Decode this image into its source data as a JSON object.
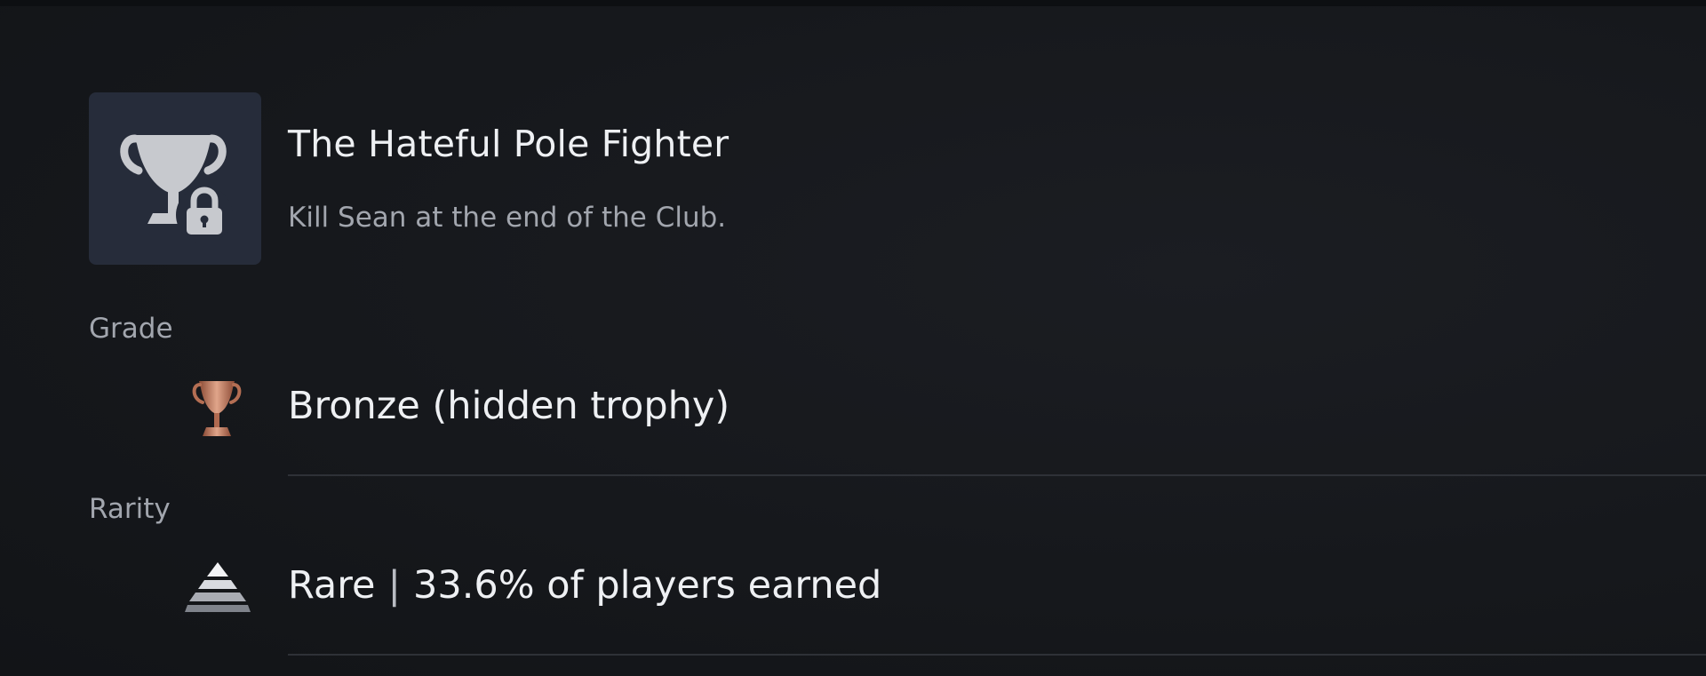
{
  "trophy": {
    "name": "The Hateful Pole Fighter",
    "description": "Kill Sean at the end of the Club.",
    "icon": "locked-trophy-icon"
  },
  "grade": {
    "label": "Grade",
    "value": "Bronze (hidden trophy)",
    "icon": "bronze-trophy-icon",
    "color": "#c07a5e"
  },
  "rarity": {
    "label": "Rarity",
    "level": "Rare",
    "separator": "|",
    "earned_text": "33.6% of players earned",
    "icon": "rarity-pyramid-icon"
  },
  "colors": {
    "background": "#16181c",
    "tile": "#262c3a",
    "text_primary": "#eef0f3",
    "text_secondary": "#a2a6ae"
  }
}
